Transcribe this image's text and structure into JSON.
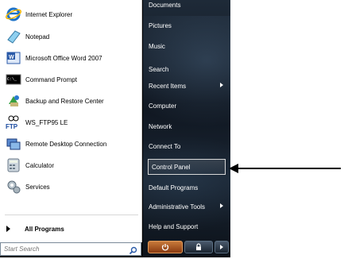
{
  "left_pane": {
    "programs": [
      {
        "label": "Internet Explorer",
        "icon": "internet-explorer-icon"
      },
      {
        "label": "Notepad",
        "icon": "notepad-icon"
      },
      {
        "label": "Microsoft Office Word 2007",
        "icon": "word-icon"
      },
      {
        "label": "Command Prompt",
        "icon": "command-prompt-icon"
      },
      {
        "label": "Backup and Restore Center",
        "icon": "backup-icon"
      },
      {
        "label": "WS_FTP95 LE",
        "icon": "ftp-icon"
      },
      {
        "label": "Remote Desktop Connection",
        "icon": "remote-desktop-icon"
      },
      {
        "label": "Calculator",
        "icon": "calculator-icon"
      },
      {
        "label": "Services",
        "icon": "services-icon"
      }
    ],
    "all_programs": "All Programs",
    "search_placeholder": "Start Search"
  },
  "right_pane": {
    "items": [
      {
        "label": "Documents"
      },
      {
        "label": "Pictures"
      },
      {
        "label": "Music"
      },
      {
        "label": "Search"
      },
      {
        "label": "Recent Items",
        "submenu": true
      },
      {
        "label": "Computer"
      },
      {
        "label": "Network"
      },
      {
        "label": "Connect To"
      },
      {
        "label": "Control Panel",
        "selected": true
      },
      {
        "label": "Default Programs"
      },
      {
        "label": "Administrative Tools",
        "submenu": true
      },
      {
        "label": "Help and Support"
      }
    ]
  },
  "colors": {
    "right_pane_bg": "#111a24",
    "highlight_border": "#d8d8d8",
    "arrow": "#000000"
  }
}
